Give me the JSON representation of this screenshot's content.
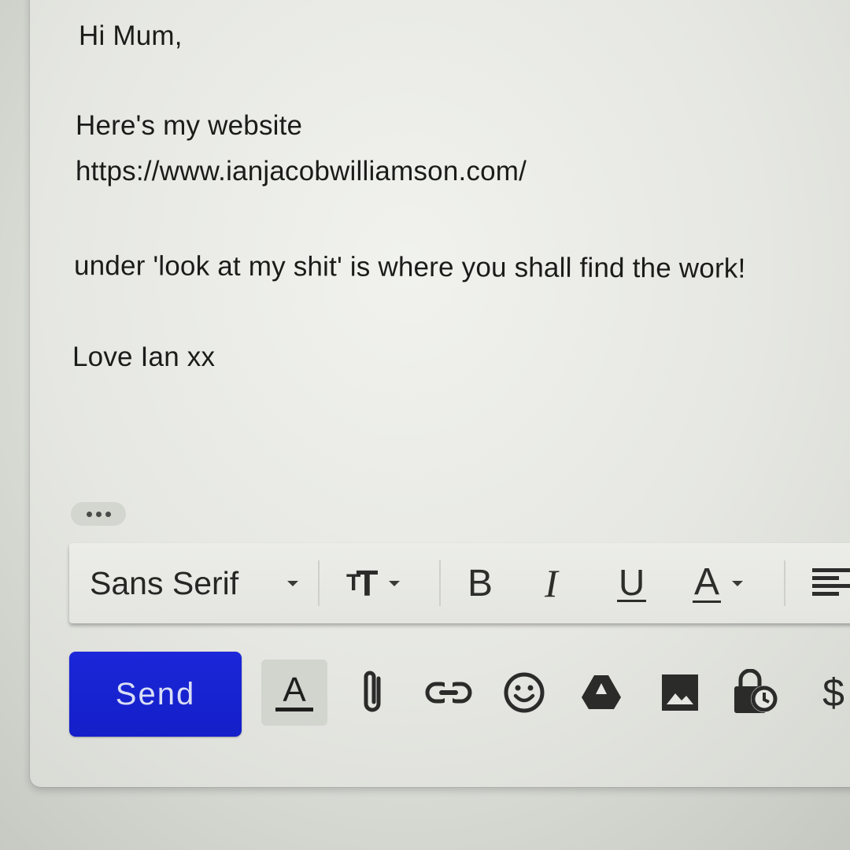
{
  "message": {
    "greeting": "Hi Mum,",
    "line_intro": "Here's my website",
    "url": "https://www.ianjacobwilliamson.com/",
    "line_instructions": "under 'look at my shit' is where you shall find the work!",
    "signoff": "Love Ian xx"
  },
  "formatting_toolbar": {
    "font_family": "Sans Serif",
    "bold_label": "B",
    "italic_label": "I",
    "underline_label": "U",
    "text_color_label": "A",
    "text_size_label": "T"
  },
  "bottom_toolbar": {
    "send_label": "Send",
    "format_toggle_label": "A",
    "dollar_label": "$",
    "icons": [
      "formatting-options-icon",
      "paperclip-icon",
      "link-icon",
      "emoji-icon",
      "drive-icon",
      "photo-icon",
      "confidential-mode-icon",
      "money-icon"
    ]
  },
  "colors": {
    "send_button": "#1b27d8",
    "page_background": "#e6e7e2",
    "text": "#1b1c1a"
  }
}
